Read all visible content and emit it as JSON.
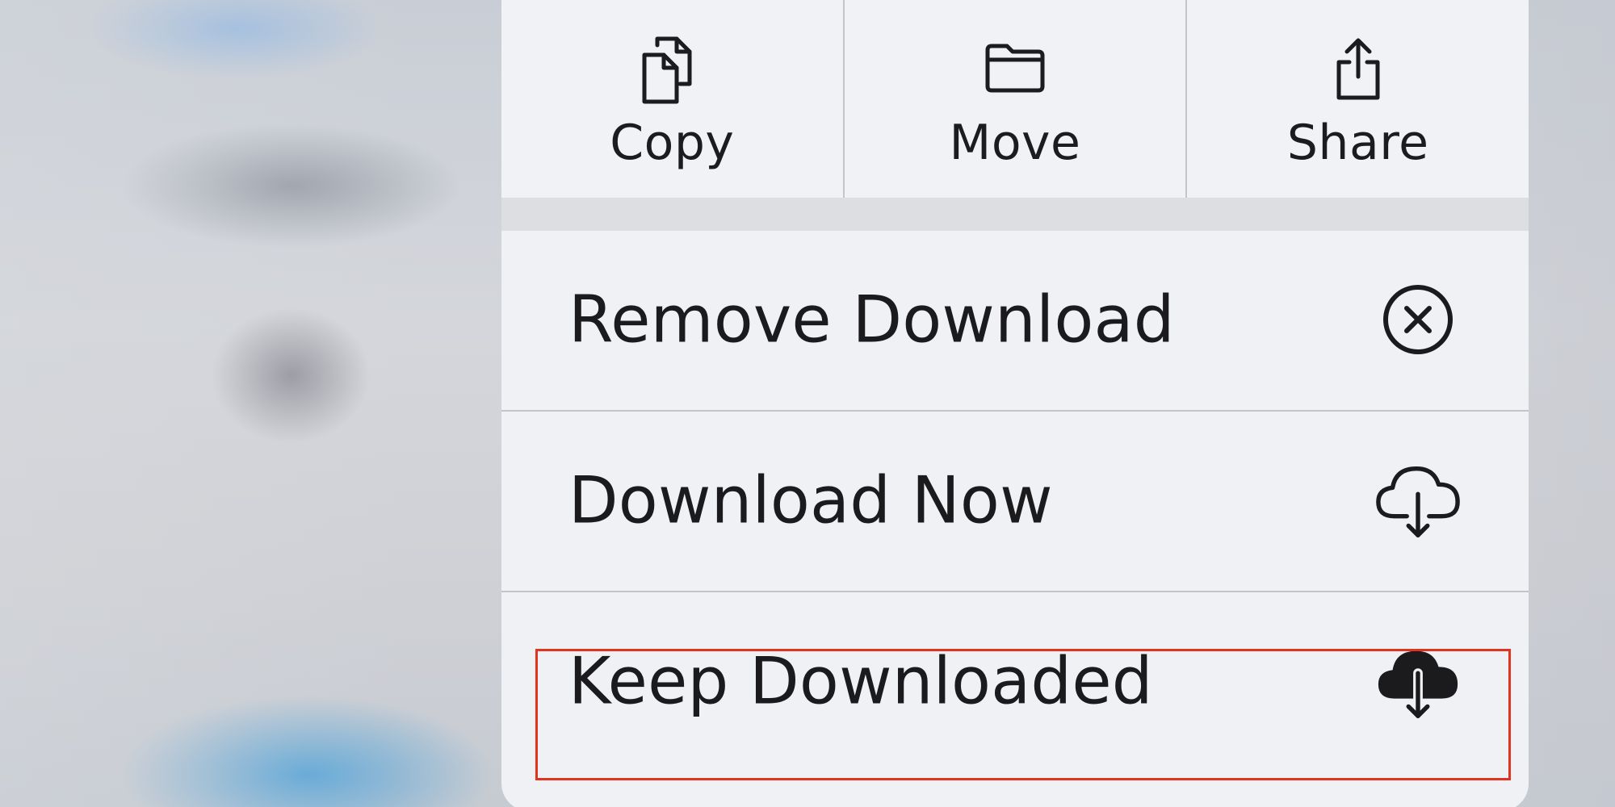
{
  "actions": [
    {
      "label": "Copy",
      "icon": "copy-icon"
    },
    {
      "label": "Move",
      "icon": "folder-icon"
    },
    {
      "label": "Share",
      "icon": "share-icon"
    }
  ],
  "items": [
    {
      "label": "Remove Download",
      "icon": "remove-circle-icon"
    },
    {
      "label": "Download Now",
      "icon": "cloud-download-outline-icon"
    },
    {
      "label": "Keep Downloaded",
      "icon": "cloud-download-filled-icon",
      "highlighted": true
    }
  ],
  "colors": {
    "highlight_border": "#e0341f",
    "menu_background": "#eff1f4",
    "text": "#1b1b1d"
  }
}
